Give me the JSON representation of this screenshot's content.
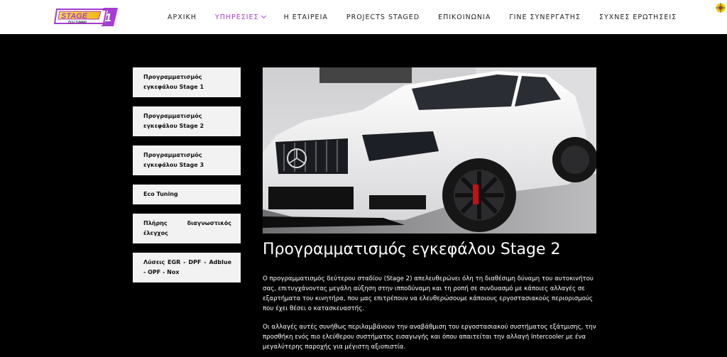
{
  "logo": {
    "text_main": "STAGE",
    "text_num": "1",
    "text_sub": "ECU TUNING"
  },
  "nav": {
    "items": [
      {
        "label": "ΑΡΧΙΚΗ"
      },
      {
        "label": "ΥΠΗΡΕΣΙΕΣ"
      },
      {
        "label": "Η ΕΤΑΙΡΕΙΑ"
      },
      {
        "label": "PROJECTS STAGED"
      },
      {
        "label": "ΕΠΙΚΟΙΝΩΝΙΑ"
      },
      {
        "label": "ΓΙΝΕ ΣΥΝΕΡΓΑΤΗΣ"
      },
      {
        "label": "ΣΥΧΝΕΣ ΕΡΩΤΗΣΕΙΣ"
      }
    ],
    "active_index": 1
  },
  "sidebar": {
    "items": [
      {
        "label": "Προγραμματισμός εγκεφάλου Stage 1"
      },
      {
        "label": "Προγραμματισμός εγκεφάλου Stage 2"
      },
      {
        "label": "Προγραμματισμός εγκεφάλου Stage 3"
      },
      {
        "label": "Eco Tuning"
      },
      {
        "label": "Πλήρης διαγνωστικός έλεγχος"
      },
      {
        "label": "Λύσεις EGR - DPF - Adblue - OPF - Nox"
      }
    ]
  },
  "main": {
    "title": "Προγραμματισμός εγκεφάλου Stage 2",
    "paragraphs": [
      "Ο προγραμματισμός δεύτερου σταδίου (Stage 2) απελευθερώνει όλη τη διαθέσιμη δύναμη του αυτοκινήτου σας, επιτυγχάνοντας μεγάλη αύξηση στην ιπποδύναμη και τη ροπή σε συνδυασμό με κάποιες αλλαγές σε εξαρτήματα του κινητήρα, που μας επιτρέπουν να ελευθερώσουμε κάποιους εργοστασιακούς περιορισμούς που έχει θέσει ο κατασκευαστής.",
      "Οι αλλαγές αυτές συνήθως περιλαμβάνουν την αναβάθμιση του εργοστασιακού συστήματος εξάτμισης, την προσθήκη ενός πιο ελεύθερου συστήματος εισαγωγής και όπου απαιτείται την αλλαγή Intercooler με ένα μεγαλύτερης παροχής για μέγιστη αξιοπιστία."
    ]
  },
  "colors": {
    "accent": "#a53ed1",
    "logo_yellow": "#f3d21b",
    "background": "#000000"
  },
  "icons": {
    "language": "greek-flag-icon",
    "dropdown": "chevron-down-icon"
  }
}
